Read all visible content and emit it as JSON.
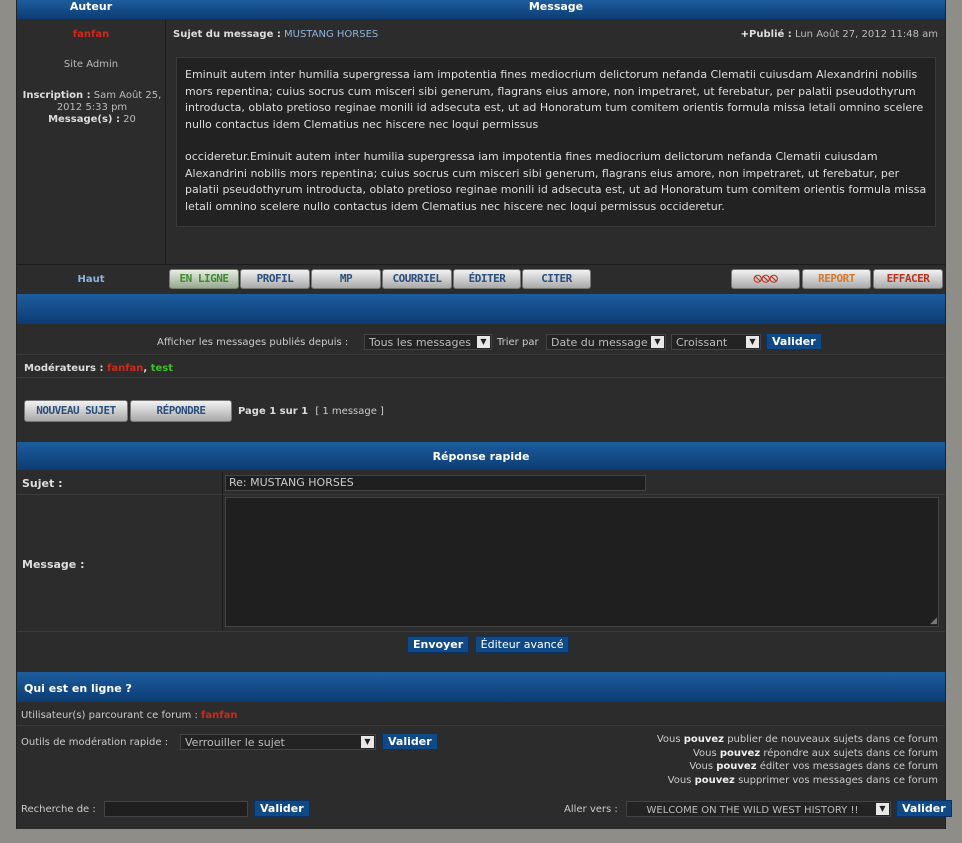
{
  "header": {
    "author_col": "Auteur",
    "message_col": "Message"
  },
  "post": {
    "author_name": "fanfan",
    "author_rank": "Site Admin",
    "inscription_label": "Inscription :",
    "inscription_value": "Sam Août 25, 2012 5:33 pm",
    "messages_label": "Message(s) :",
    "messages_value": "20",
    "subject_label": "Sujet du message :",
    "subject_value": "MUSTANG HORSES",
    "posted_label": "Publié :",
    "posted_value": "Lun Août 27, 2012 11:48 am",
    "body_p1": "Eminuit autem inter humilia supergressa iam impotentia fines mediocrium delictorum nefanda Clematii cuiusdam Alexandrini nobilis mors repentina; cuius socrus cum misceri sibi generum, flagrans eius amore, non impetraret, ut ferebatur, per palatii pseudothyrum introducta, oblato pretioso reginae monili id adsecuta est, ut ad Honoratum tum comitem orientis formula missa letali omnino scelere nullo contactus idem Clematius nec hiscere nec loqui permissus",
    "body_p2": "occideretur.Eminuit autem inter humilia supergressa iam impotentia fines mediocrium delictorum nefanda Clematii cuiusdam Alexandrini nobilis mors repentina; cuius socrus cum misceri sibi generum, flagrans eius amore, non impetraret, ut ferebatur, per palatii pseudothyrum introducta, oblato pretioso reginae monili id adsecuta est, ut ad Honoratum tum comitem orientis formula missa letali omnino scelere nullo contactus idem Clematius nec hiscere nec loqui permissus occideretur."
  },
  "actions": {
    "top_link": "Haut",
    "online": "EN LIGNE",
    "profile": "PROFIL",
    "pm": "MP",
    "email": "COURRIEL",
    "edit": "ÉDITER",
    "quote": "CITER",
    "report": "REPORT",
    "delete": "EFFACER",
    "ban_icons": "⦸⦸⦸"
  },
  "filter": {
    "label": "Afficher les messages publiés depuis :",
    "since": "Tous les messages",
    "sort_label": "Trier par",
    "sort_by": "Date du message",
    "order": "Croissant",
    "submit": "Valider"
  },
  "moderators": {
    "label": "Modérateurs :",
    "mod1": "fanfan",
    "sep": ",",
    "mod2": "test"
  },
  "pagination": {
    "new_topic": "NOUVEAU SUJET",
    "reply": "RÉPONDRE",
    "page_info": "Page 1 sur 1",
    "count": "[ 1 message ]"
  },
  "quick_reply": {
    "title": "Réponse rapide",
    "subject_label": "Sujet :",
    "subject_value": "Re: MUSTANG HORSES",
    "message_label": "Message :",
    "send": "Envoyer",
    "advanced": "Éditeur avancé"
  },
  "online": {
    "title": "Qui est en ligne ?",
    "browsing_label": "Utilisateur(s) parcourant ce forum :",
    "browsing_user": "fanfan",
    "modtools_label": "Outils de modération rapide :",
    "modtools_value": "Verrouiller le sujet",
    "modtools_submit": "Valider",
    "perm1_a": "Vous",
    "perm1_b": "pouvez",
    "perm1_c": "publier de nouveaux sujets dans ce forum",
    "perm2_a": "Vous",
    "perm2_b": "pouvez",
    "perm2_c": "répondre aux sujets dans ce forum",
    "perm3_a": "Vous",
    "perm3_b": "pouvez",
    "perm3_c": "éditer vos messages dans ce forum",
    "perm4_a": "Vous",
    "perm4_b": "pouvez",
    "perm4_c": "supprimer vos messages dans ce forum",
    "search_label": "Recherche de :",
    "search_submit": "Valider",
    "goto_label": "Aller vers :",
    "goto_value": "WELCOME ON THE WILD WEST HISTORY !!",
    "goto_submit": "Valider"
  }
}
